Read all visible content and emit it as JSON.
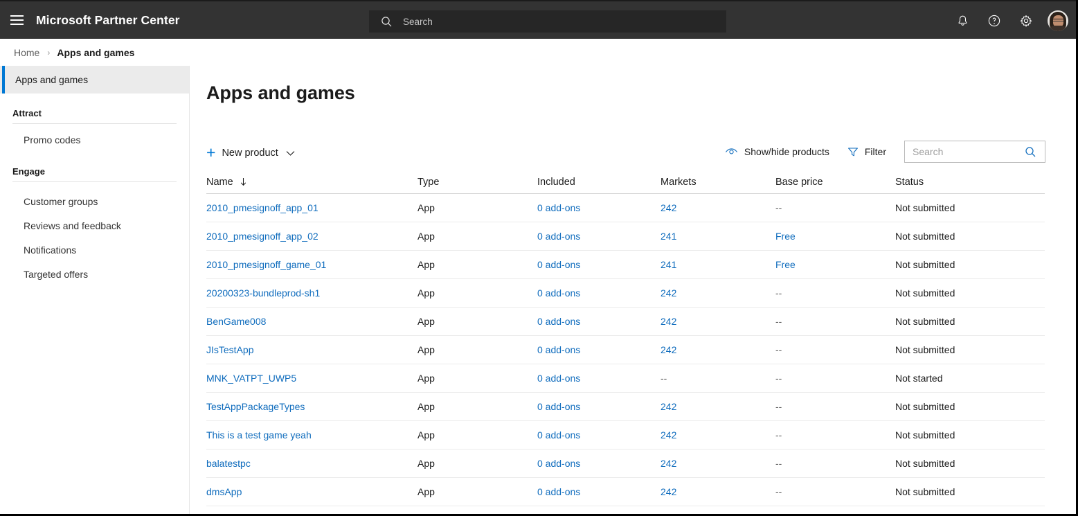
{
  "topbar": {
    "menu_icon": "hamburger-icon",
    "brand": "Microsoft Partner Center",
    "search_placeholder": "Search",
    "search_icon": "search-icon",
    "notifications_icon": "bell-icon",
    "help_icon": "question-circle-icon",
    "settings_icon": "gear-icon",
    "avatar": "user-avatar"
  },
  "breadcrumb": {
    "home": "Home",
    "separator": "›",
    "current": "Apps and games"
  },
  "sidebar": {
    "selected": "Apps and games",
    "groups": [
      {
        "title": "Attract",
        "items": [
          {
            "label": "Promo codes"
          }
        ]
      },
      {
        "title": "Engage",
        "items": [
          {
            "label": "Customer groups"
          },
          {
            "label": "Reviews and feedback"
          },
          {
            "label": "Notifications"
          },
          {
            "label": "Targeted offers"
          }
        ]
      }
    ]
  },
  "main": {
    "title": "Apps and games",
    "toolbar": {
      "new_product_label": "New product",
      "new_product_plus_icon": "plus-icon",
      "new_product_chevron_icon": "chevron-down-icon",
      "show_hide_label": "Show/hide products",
      "show_hide_icon": "eye-icon",
      "filter_label": "Filter",
      "filter_icon": "funnel-icon",
      "search_placeholder": "Search",
      "search_icon": "search-icon"
    },
    "table": {
      "columns": [
        "Name",
        "Type",
        "Included",
        "Markets",
        "Base price",
        "Status"
      ],
      "sort_column": "Name",
      "sort_direction_icon": "arrow-down-icon",
      "rows": [
        {
          "name": "2010_pmesignoff_app_01",
          "type": "App",
          "included": "0 add-ons",
          "markets": "242",
          "base_price": "--",
          "status": "Not submitted"
        },
        {
          "name": "2010_pmesignoff_app_02",
          "type": "App",
          "included": "0 add-ons",
          "markets": "241",
          "base_price": "Free",
          "status": "Not submitted"
        },
        {
          "name": "2010_pmesignoff_game_01",
          "type": "App",
          "included": "0 add-ons",
          "markets": "241",
          "base_price": "Free",
          "status": "Not submitted"
        },
        {
          "name": "20200323-bundleprod-sh1",
          "type": "App",
          "included": "0 add-ons",
          "markets": "242",
          "base_price": "--",
          "status": "Not submitted"
        },
        {
          "name": "BenGame008",
          "type": "App",
          "included": "0 add-ons",
          "markets": "242",
          "base_price": "--",
          "status": "Not submitted"
        },
        {
          "name": "JIsTestApp",
          "type": "App",
          "included": "0 add-ons",
          "markets": "242",
          "base_price": "--",
          "status": "Not submitted"
        },
        {
          "name": "MNK_VATPT_UWP5",
          "type": "App",
          "included": "0 add-ons",
          "markets": "--",
          "base_price": "--",
          "status": "Not started"
        },
        {
          "name": "TestAppPackageTypes",
          "type": "App",
          "included": "0 add-ons",
          "markets": "242",
          "base_price": "--",
          "status": "Not submitted"
        },
        {
          "name": "This is a test game yeah",
          "type": "App",
          "included": "0 add-ons",
          "markets": "242",
          "base_price": "--",
          "status": "Not submitted"
        },
        {
          "name": "balatestpc",
          "type": "App",
          "included": "0 add-ons",
          "markets": "242",
          "base_price": "--",
          "status": "Not submitted"
        },
        {
          "name": "dmsApp",
          "type": "App",
          "included": "0 add-ons",
          "markets": "242",
          "base_price": "--",
          "status": "Not submitted"
        }
      ]
    }
  },
  "colors": {
    "topbar_bg": "#333333",
    "accent_blue": "#0078d4",
    "link_blue": "#0f6cbd",
    "selected_bg": "#ebebeb"
  }
}
